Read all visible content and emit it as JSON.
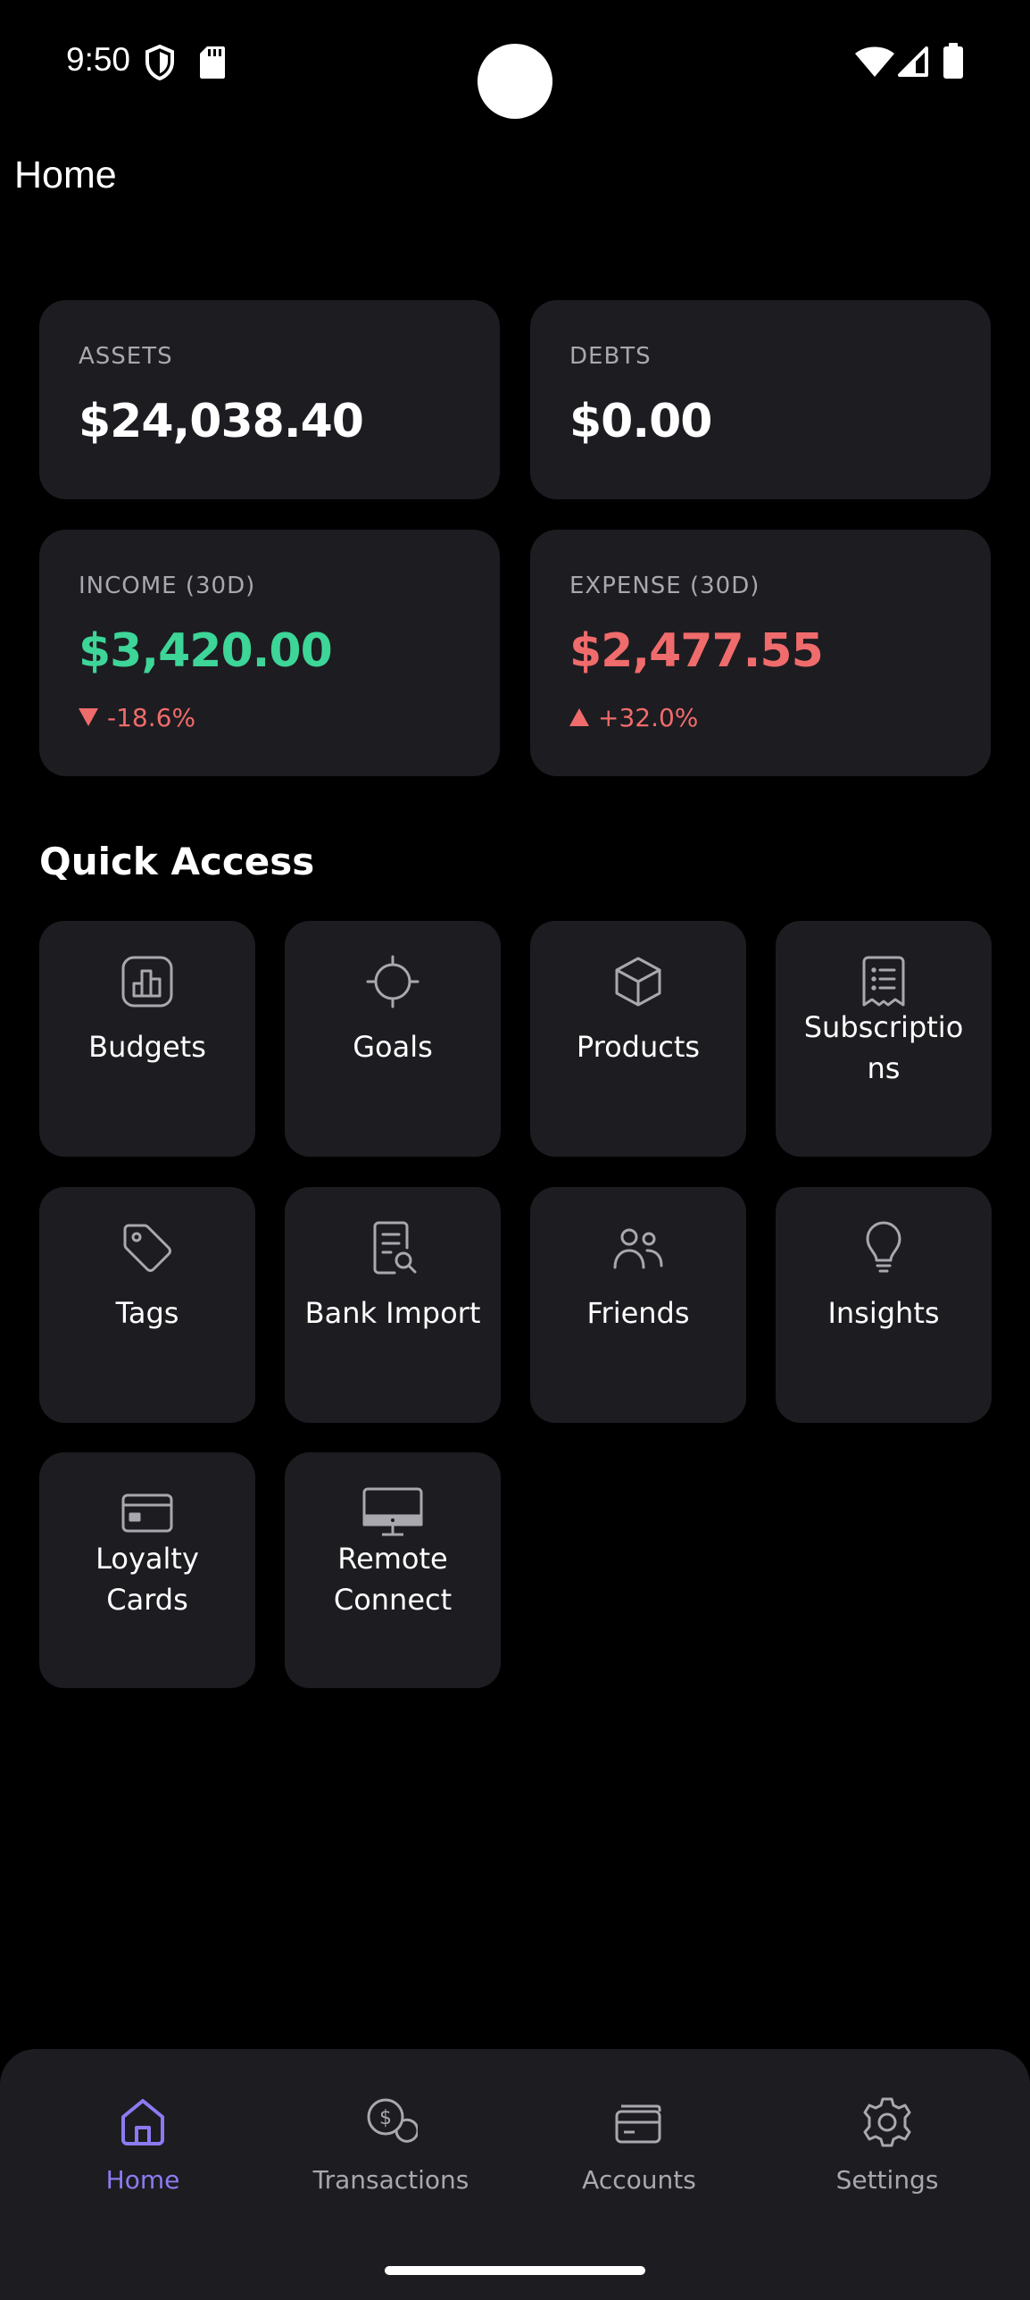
{
  "status_bar": {
    "time": "9:50",
    "icons": [
      "shield-icon",
      "sd-card-icon",
      "wifi-icon",
      "signal-icon",
      "battery-icon"
    ]
  },
  "header": {
    "title": "Home"
  },
  "summary": {
    "assets": {
      "label": "ASSETS",
      "value": "$24,038.40"
    },
    "debts": {
      "label": "DEBTS",
      "value": "$0.00"
    },
    "income": {
      "label": "INCOME (30D)",
      "value": "$3,420.00",
      "change": "-18.6%",
      "direction": "down",
      "value_color": "#3dd598"
    },
    "expense": {
      "label": "EXPENSE (30D)",
      "value": "$2,477.55",
      "change": "+32.0%",
      "direction": "up",
      "value_color": "#f06b6b"
    }
  },
  "quick_access": {
    "title": "Quick Access",
    "items": [
      {
        "label": "Budgets",
        "icon": "bar-chart-icon"
      },
      {
        "label": "Goals",
        "icon": "crosshair-icon"
      },
      {
        "label": "Products",
        "icon": "box-icon"
      },
      {
        "label": "Subscriptions",
        "icon": "receipt-icon"
      },
      {
        "label": "Tags",
        "icon": "tag-icon"
      },
      {
        "label": "Bank Import",
        "icon": "document-search-icon"
      },
      {
        "label": "Friends",
        "icon": "users-icon"
      },
      {
        "label": "Insights",
        "icon": "lightbulb-icon"
      },
      {
        "label": "Loyalty Cards",
        "icon": "credit-card-icon"
      },
      {
        "label": "Remote Connect",
        "icon": "monitor-icon"
      }
    ]
  },
  "bottom_nav": {
    "items": [
      {
        "label": "Home",
        "icon": "home-icon",
        "active": true
      },
      {
        "label": "Transactions",
        "icon": "coins-icon",
        "active": false
      },
      {
        "label": "Accounts",
        "icon": "wallet-icon",
        "active": false
      },
      {
        "label": "Settings",
        "icon": "gear-icon",
        "active": false
      }
    ]
  },
  "colors": {
    "background": "#000000",
    "card": "#1d1c21",
    "accent": "#8b7bf2",
    "positive": "#3dd598",
    "negative": "#f06b6b",
    "muted": "#a9a8ae"
  }
}
